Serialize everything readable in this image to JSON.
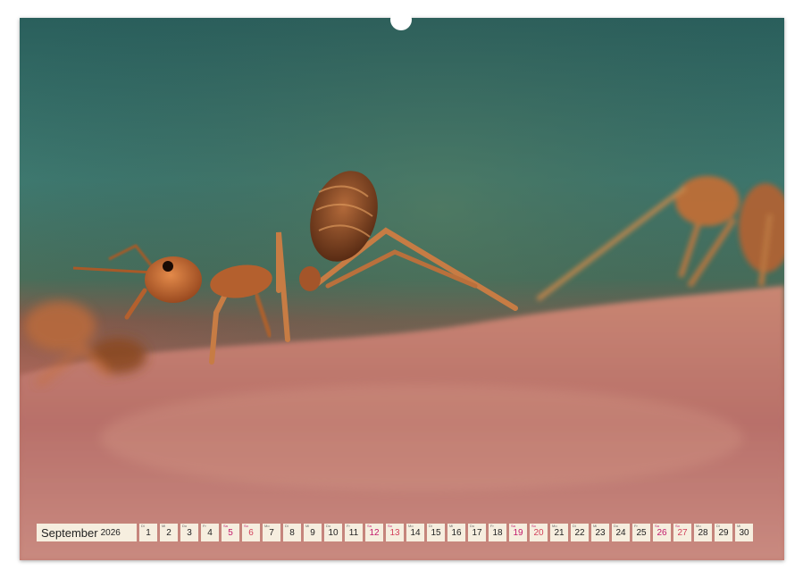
{
  "calendar": {
    "month": "September",
    "year": "2026",
    "days": [
      {
        "num": "1",
        "wd": "Di",
        "type": "weekday"
      },
      {
        "num": "2",
        "wd": "Mi",
        "type": "weekday"
      },
      {
        "num": "3",
        "wd": "Do",
        "type": "weekday"
      },
      {
        "num": "4",
        "wd": "Fr",
        "type": "weekday"
      },
      {
        "num": "5",
        "wd": "Sa",
        "type": "sat"
      },
      {
        "num": "6",
        "wd": "So",
        "type": "sun"
      },
      {
        "num": "7",
        "wd": "Mo",
        "type": "weekday"
      },
      {
        "num": "8",
        "wd": "Di",
        "type": "weekday"
      },
      {
        "num": "9",
        "wd": "Mi",
        "type": "weekday"
      },
      {
        "num": "10",
        "wd": "Do",
        "type": "weekday"
      },
      {
        "num": "11",
        "wd": "Fr",
        "type": "weekday"
      },
      {
        "num": "12",
        "wd": "Sa",
        "type": "sat"
      },
      {
        "num": "13",
        "wd": "So",
        "type": "sun"
      },
      {
        "num": "14",
        "wd": "Mo",
        "type": "weekday"
      },
      {
        "num": "15",
        "wd": "Di",
        "type": "weekday"
      },
      {
        "num": "16",
        "wd": "Mi",
        "type": "weekday"
      },
      {
        "num": "17",
        "wd": "Do",
        "type": "weekday"
      },
      {
        "num": "18",
        "wd": "Fr",
        "type": "weekday"
      },
      {
        "num": "19",
        "wd": "Sa",
        "type": "sat"
      },
      {
        "num": "20",
        "wd": "So",
        "type": "sun"
      },
      {
        "num": "21",
        "wd": "Mo",
        "type": "weekday"
      },
      {
        "num": "22",
        "wd": "Di",
        "type": "weekday"
      },
      {
        "num": "23",
        "wd": "Mi",
        "type": "weekday"
      },
      {
        "num": "24",
        "wd": "Do",
        "type": "weekday"
      },
      {
        "num": "25",
        "wd": "Fr",
        "type": "weekday"
      },
      {
        "num": "26",
        "wd": "Sa",
        "type": "sat"
      },
      {
        "num": "27",
        "wd": "So",
        "type": "sun"
      },
      {
        "num": "28",
        "wd": "Mo",
        "type": "weekday"
      },
      {
        "num": "29",
        "wd": "Di",
        "type": "weekday"
      },
      {
        "num": "30",
        "wd": "Mi",
        "type": "weekday"
      }
    ]
  },
  "colors": {
    "strip_background": "#f6eedf",
    "saturday": "#c2186b",
    "sunday": "#d2405a",
    "background_teal": "#2a5f5c",
    "foreground_pink": "#c07a70"
  },
  "photo": {
    "subject": "ant-macro-photo"
  }
}
